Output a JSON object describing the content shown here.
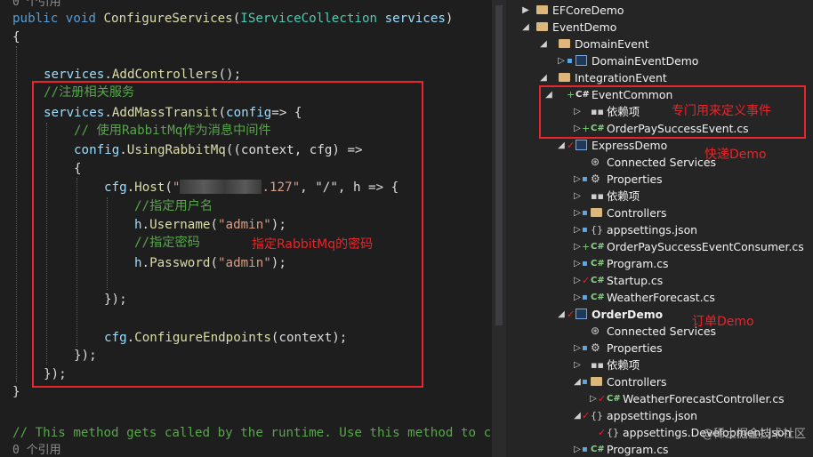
{
  "editor": {
    "ref_top": "0 个引用",
    "signature": {
      "kw1": "public",
      "kw2": "void",
      "method": "ConfigureServices",
      "type": "IServiceCollection",
      "param": "services"
    },
    "open_brace": "{",
    "add_controllers": {
      "obj": "services",
      "method": "AddControllers",
      "rest": "();"
    },
    "comment_register": "//注册相关服务",
    "add_mass": {
      "obj": "services",
      "method": "AddMassTransit",
      "param": "config",
      "rest": "=> {"
    },
    "comment_use": "// 使用RabbitMq作为消息中间件",
    "using_rabbit": {
      "obj": "config",
      "method": "UsingRabbitMq",
      "rest": "((context, cfg) =>"
    },
    "brace_open_2": "{",
    "host": {
      "obj": "cfg",
      "method": "Host",
      "str_start": "\"",
      "str_end": ".127\"",
      "rest": ", \"/\", h => {"
    },
    "comment_user": "//指定用户名",
    "username": {
      "obj": "h",
      "method": "Username",
      "str": "\"admin\"",
      "rest": ");"
    },
    "comment_pwd": "//指定密码",
    "password": {
      "obj": "h",
      "method": "Password",
      "str": "\"admin\"",
      "rest": ");"
    },
    "close_host": "});",
    "configure": {
      "obj": "cfg",
      "method": "ConfigureEndpoints",
      "rest": "(context);"
    },
    "close_using": "});",
    "close_mass": "});",
    "close_method": "}",
    "comment_bottom": "// This method gets called by the runtime. Use this method to c",
    "ref_bottom": "0 个引用"
  },
  "annotations": {
    "rabbit_password": "指定RabbitMq的密码",
    "event_common": "专门用来定义事件",
    "express": "快递Demo",
    "order": "订单Demo"
  },
  "colors": {
    "annotation": "#e8252a",
    "folder": "#dcb67a",
    "comment": "#57a64a",
    "keyword": "#569cd6"
  },
  "explorer": {
    "rows": [
      {
        "label": "EFCoreDemo",
        "icon": "folder-icon",
        "arrow": "▶"
      },
      {
        "label": "EventDemo",
        "icon": "folder-icon",
        "arrow": "◢"
      },
      {
        "label": "DomainEvent",
        "icon": "folder-icon",
        "arrow": "◢"
      },
      {
        "label": "DomainEventDemo",
        "icon": "project-icon",
        "arrow": "▷"
      },
      {
        "label": "IntegrationEvent",
        "icon": "folder-icon",
        "arrow": "◢"
      },
      {
        "label": "EventCommon",
        "icon": "csharp-project-icon",
        "arrow": "◢"
      },
      {
        "label": "依赖项",
        "icon": "dependencies-icon",
        "arrow": "▷"
      },
      {
        "label": "OrderPaySuccessEvent.cs",
        "icon": "csharp-file-icon",
        "arrow": "▷"
      },
      {
        "label": "ExpressDemo",
        "icon": "project-icon",
        "arrow": "◢"
      },
      {
        "label": "Connected Services",
        "icon": "connected-services-icon",
        "arrow": ""
      },
      {
        "label": "Properties",
        "icon": "properties-icon",
        "arrow": "▷"
      },
      {
        "label": "依赖项",
        "icon": "dependencies-icon",
        "arrow": "▷"
      },
      {
        "label": "Controllers",
        "icon": "folder-icon",
        "arrow": "▷"
      },
      {
        "label": "appsettings.json",
        "icon": "json-file-icon",
        "arrow": "▷"
      },
      {
        "label": "OrderPaySuccessEventConsumer.cs",
        "icon": "csharp-file-icon",
        "arrow": "▷"
      },
      {
        "label": "Program.cs",
        "icon": "csharp-file-icon",
        "arrow": "▷"
      },
      {
        "label": "Startup.cs",
        "icon": "csharp-file-icon",
        "arrow": "▷"
      },
      {
        "label": "WeatherForecast.cs",
        "icon": "csharp-file-icon",
        "arrow": "▷"
      },
      {
        "label": "OrderDemo",
        "icon": "project-icon",
        "arrow": "◢"
      },
      {
        "label": "Connected Services",
        "icon": "connected-services-icon",
        "arrow": ""
      },
      {
        "label": "Properties",
        "icon": "properties-icon",
        "arrow": "▷"
      },
      {
        "label": "依赖项",
        "icon": "dependencies-icon",
        "arrow": "▷"
      },
      {
        "label": "Controllers",
        "icon": "folder-icon",
        "arrow": "◢"
      },
      {
        "label": "WeatherForecastController.cs",
        "icon": "csharp-file-icon",
        "arrow": "▷"
      },
      {
        "label": "appsettings.json",
        "icon": "json-file-icon",
        "arrow": "◢"
      },
      {
        "label": "appsettings.Development.json",
        "icon": "json-file-icon",
        "arrow": ""
      },
      {
        "label": "Program.cs",
        "icon": "csharp-file-icon",
        "arrow": "▷"
      }
    ],
    "watermark": "@稀土掘金技术社区"
  }
}
